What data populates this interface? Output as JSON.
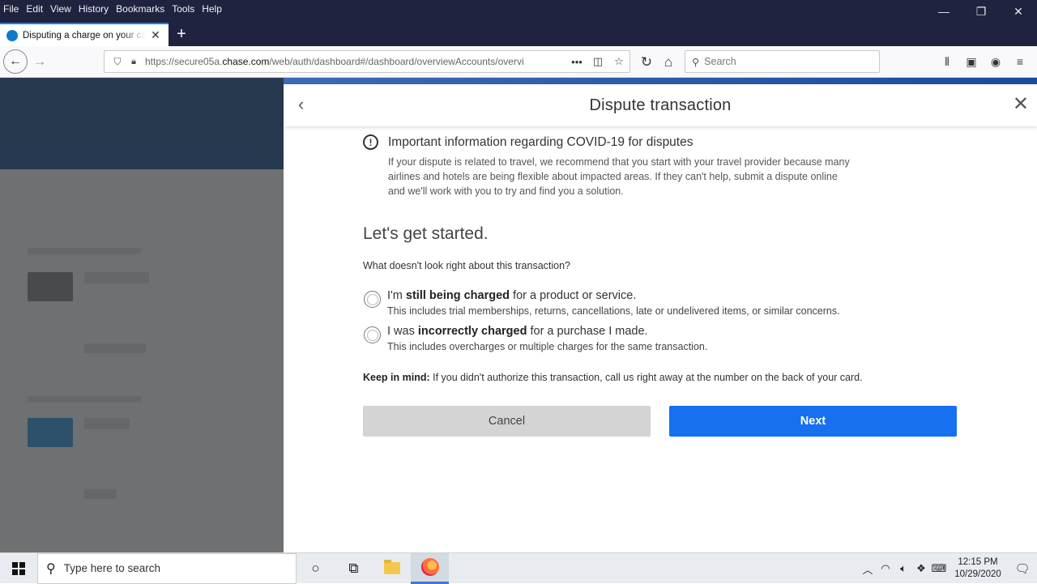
{
  "browser": {
    "menu": [
      "File",
      "Edit",
      "View",
      "History",
      "Bookmarks",
      "Tools",
      "Help"
    ],
    "tab_title": "Disputing a charge on your card",
    "url_prefix": "https://secure05a.",
    "url_domain": "chase.com",
    "url_path": "/web/auth/dashboard#/dashboard/overviewAccounts/overvi",
    "search_placeholder": "Search"
  },
  "modal": {
    "title": "Dispute transaction",
    "covid_heading": "Important information regarding COVID-19 for disputes",
    "covid_body": "If your dispute is related to travel, we recommend that you start with your travel provider because many airlines and hotels are being flexible about impacted areas. If they can't help, submit a dispute online and we'll work with you to try and find you a solution.",
    "heading": "Let's get started.",
    "question": "What doesn't look right about this transaction?",
    "option1": {
      "pre": "I'm ",
      "bold": "still being charged",
      "post": " for a product or service.",
      "sub": "This includes trial memberships, returns, cancellations, late or undelivered items, or similar concerns."
    },
    "option2": {
      "pre": "I was ",
      "bold": "incorrectly charged",
      "post": " for a purchase I made.",
      "sub": "This includes overcharges or multiple charges for the same transaction."
    },
    "keep_bold": "Keep in mind:",
    "keep_text": " If you didn't authorize this transaction, call us right away at the number on the back of your card.",
    "cancel_label": "Cancel",
    "next_label": "Next"
  },
  "taskbar": {
    "search_placeholder": "Type here to search",
    "time": "12:15 PM",
    "date": "10/29/2020"
  },
  "icons": {
    "back": "back-arrow-icon",
    "forward": "forward-arrow-icon",
    "close": "close-icon",
    "info": "info-icon"
  },
  "colors": {
    "primary_button": "#1670f0",
    "secondary_button": "#d4d4d4",
    "titlebar": "#202340"
  }
}
